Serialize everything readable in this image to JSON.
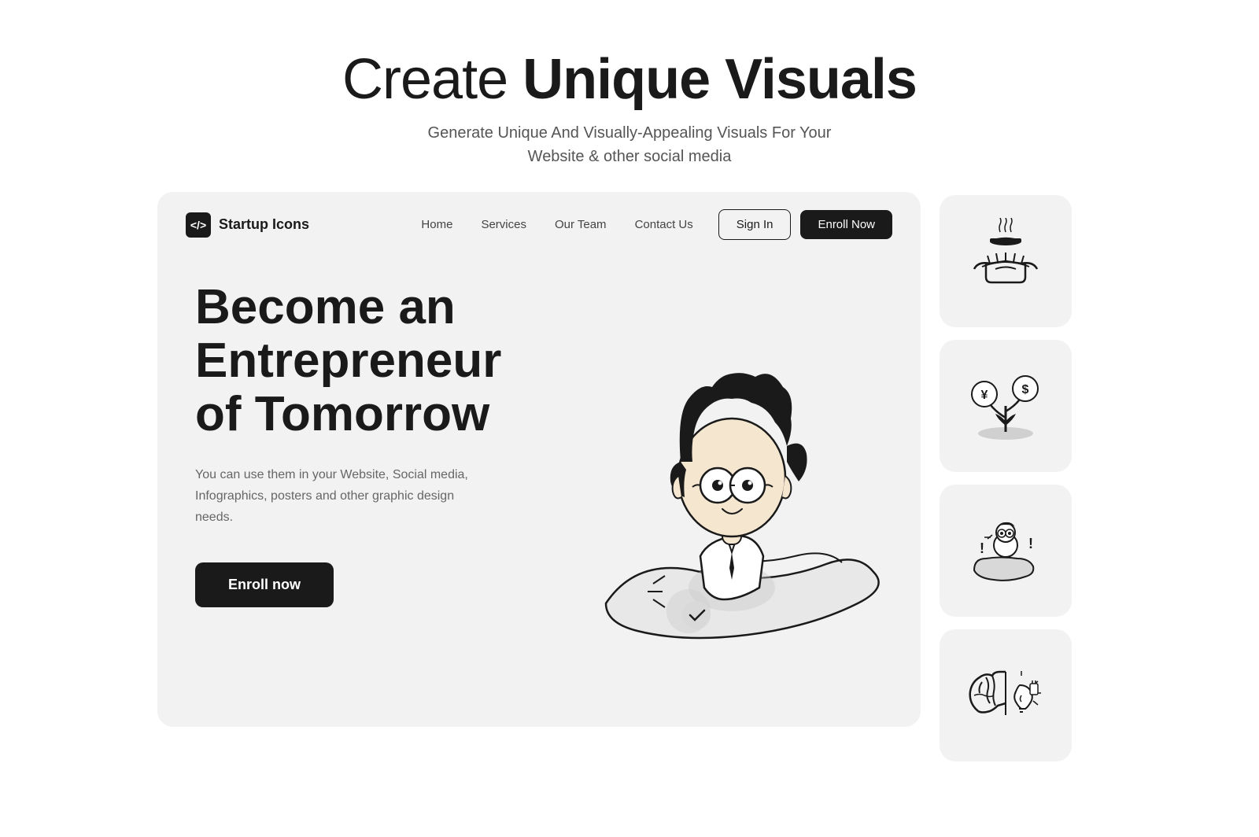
{
  "page": {
    "heading": {
      "title_normal": "Create ",
      "title_bold": "Unique Visuals",
      "subtitle": "Generate Unique And Visually-Appealing Visuals For Your\nWebsite & other social media"
    },
    "navbar": {
      "brand_name": "Startup Icons",
      "brand_icon": "</>",
      "nav_links": [
        "Home",
        "Services",
        "Our Team",
        "Contact Us"
      ],
      "signin_label": "Sign In",
      "enroll_label": "Enroll Now"
    },
    "hero": {
      "title": "Become an Entrepreneur of Tomorrow",
      "description": "You can use them in your Website, Social media, Infographics, posters and other graphic design needs.",
      "cta_label": "Enroll now"
    }
  }
}
